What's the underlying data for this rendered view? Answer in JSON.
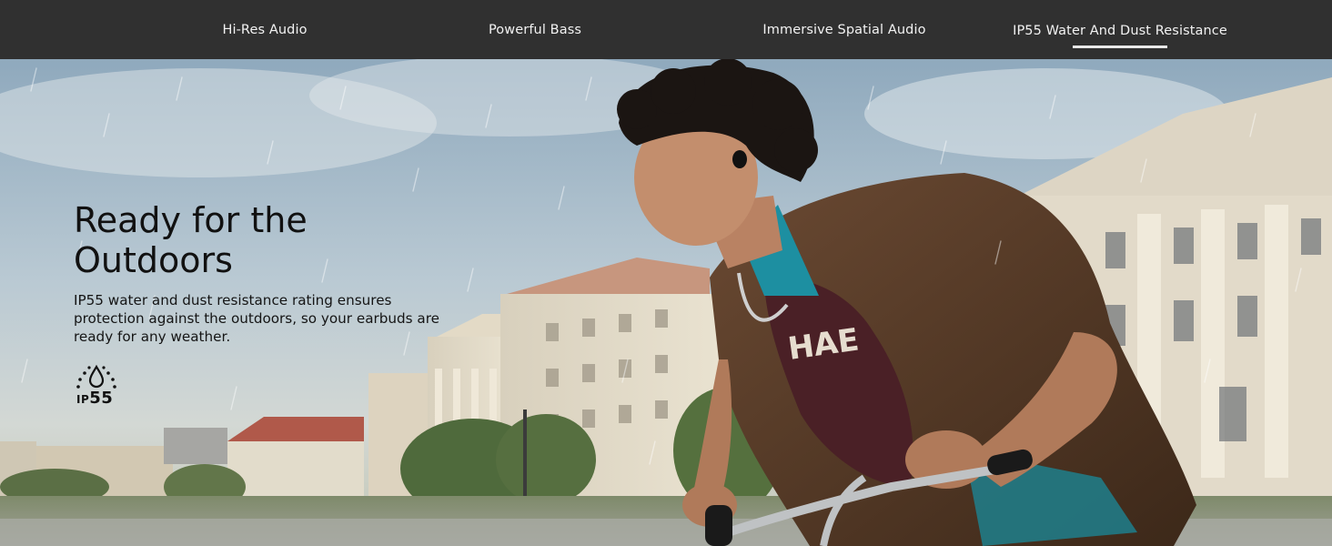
{
  "tabs": [
    {
      "label": "Hi-Res Audio",
      "active": false
    },
    {
      "label": "Powerful Bass",
      "active": false
    },
    {
      "label": "Immersive Spatial Audio",
      "active": false
    },
    {
      "label": "IP55 Water And Dust Resistance",
      "active": true
    }
  ],
  "hero": {
    "headline_line1": "Ready for the",
    "headline_line2": "Outdoors",
    "description": "IP55 water and dust resistance rating ensures protection against the outdoors, so your earbuds are ready for any weather.",
    "badge_prefix": "IP",
    "badge_number": "55",
    "badge_icon": "water-drop-dust-icon"
  },
  "colors": {
    "tab_bar": "#303030",
    "tab_text": "#f2f2f2",
    "active_underline": "#e8e8e8",
    "headline_text": "#111111"
  }
}
